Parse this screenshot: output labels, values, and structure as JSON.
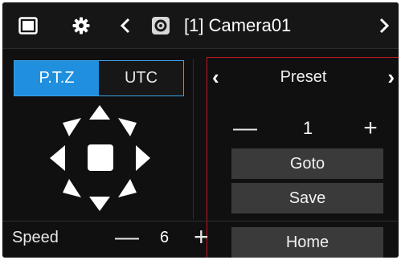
{
  "topbar": {
    "icons": [
      "window-icon",
      "gear-icon",
      "chevron-left-icon",
      "camera-icon",
      "chevron-right-icon"
    ],
    "camera_title": "[1] Camera01"
  },
  "tabs": [
    {
      "label": "P.T.Z",
      "active": true
    },
    {
      "label": "UTC",
      "active": false
    }
  ],
  "preset": {
    "label": "Preset",
    "value": "1",
    "goto_label": "Goto",
    "save_label": "Save",
    "home_label": "Home"
  },
  "speed": {
    "label": "Speed",
    "value": "6"
  },
  "colors": {
    "background": "#101010",
    "accent": "#1f8fde",
    "button": "#3a3a3a",
    "highlight_border": "#c2181e"
  }
}
